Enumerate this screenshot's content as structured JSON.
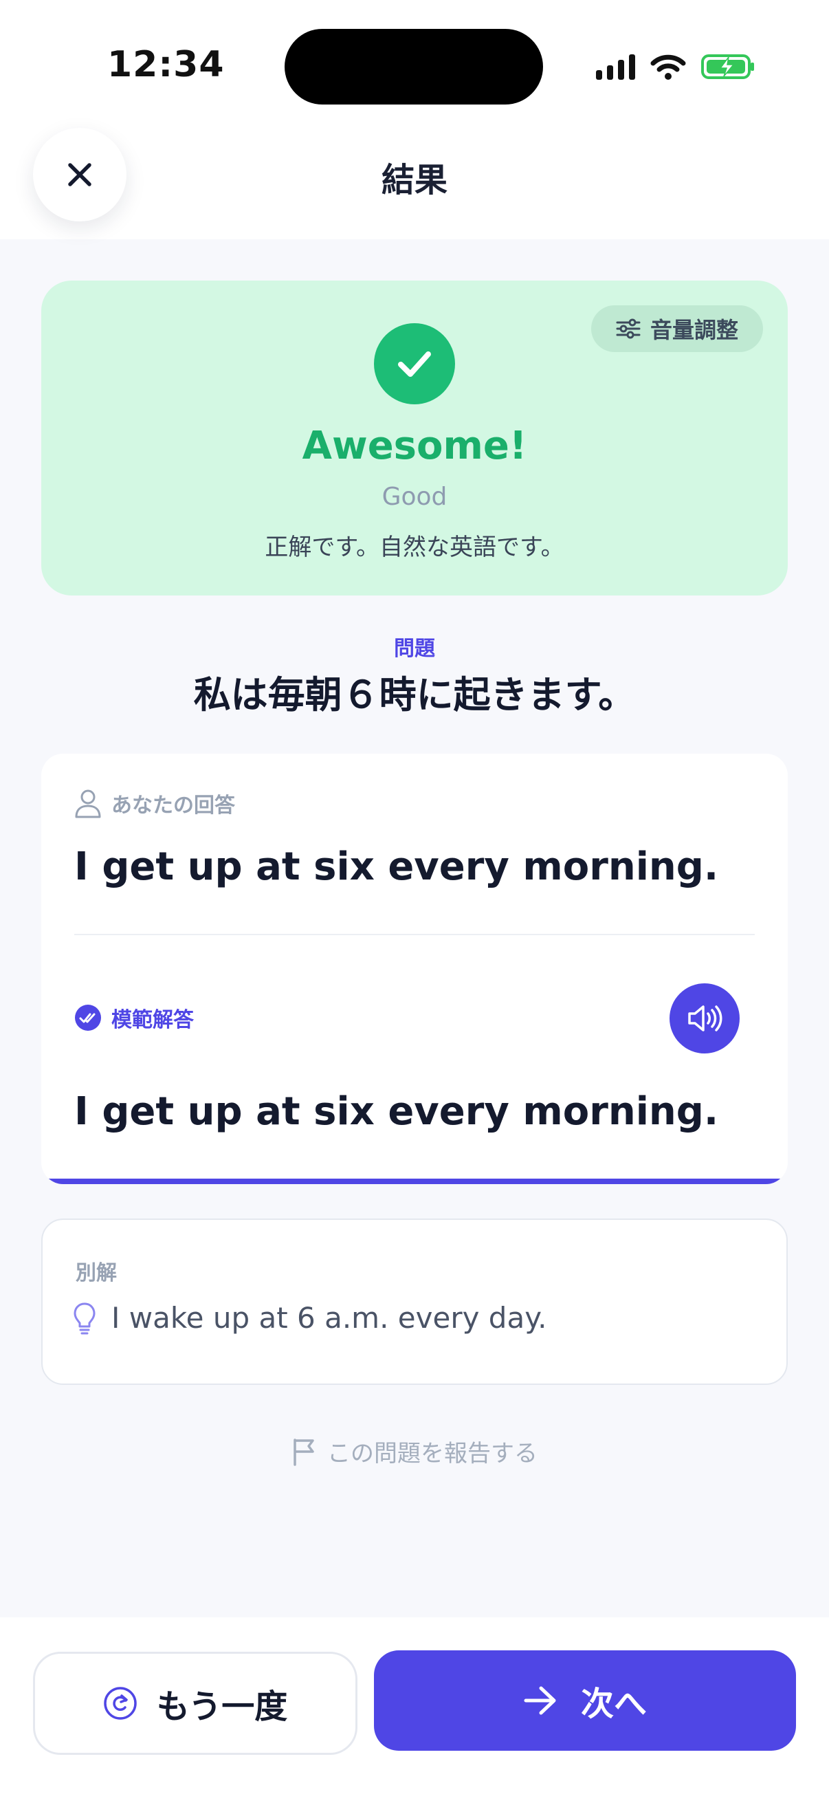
{
  "status_bar": {
    "time": "12:34"
  },
  "header": {
    "title": "結果",
    "close_icon": "close-icon"
  },
  "result": {
    "volume_label": "音量調整",
    "title": "Awesome!",
    "grade": "Good",
    "message": "正解です。自然な英語です。",
    "accent_color": "#1aaf6b"
  },
  "question": {
    "label": "問題",
    "text": "私は毎朝６時に起きます。"
  },
  "answers": {
    "user_label": "あなたの回答",
    "user_answer": "I get up at six every morning.",
    "model_label": "模範解答",
    "model_answer": "I get up at six every morning."
  },
  "alternative": {
    "label": "別解",
    "text": "I wake up at 6 a.m. every day."
  },
  "report": {
    "label": "この問題を報告する"
  },
  "actions": {
    "retry_label": "もう一度",
    "next_label": "次へ",
    "primary_color": "#4f46e5"
  }
}
